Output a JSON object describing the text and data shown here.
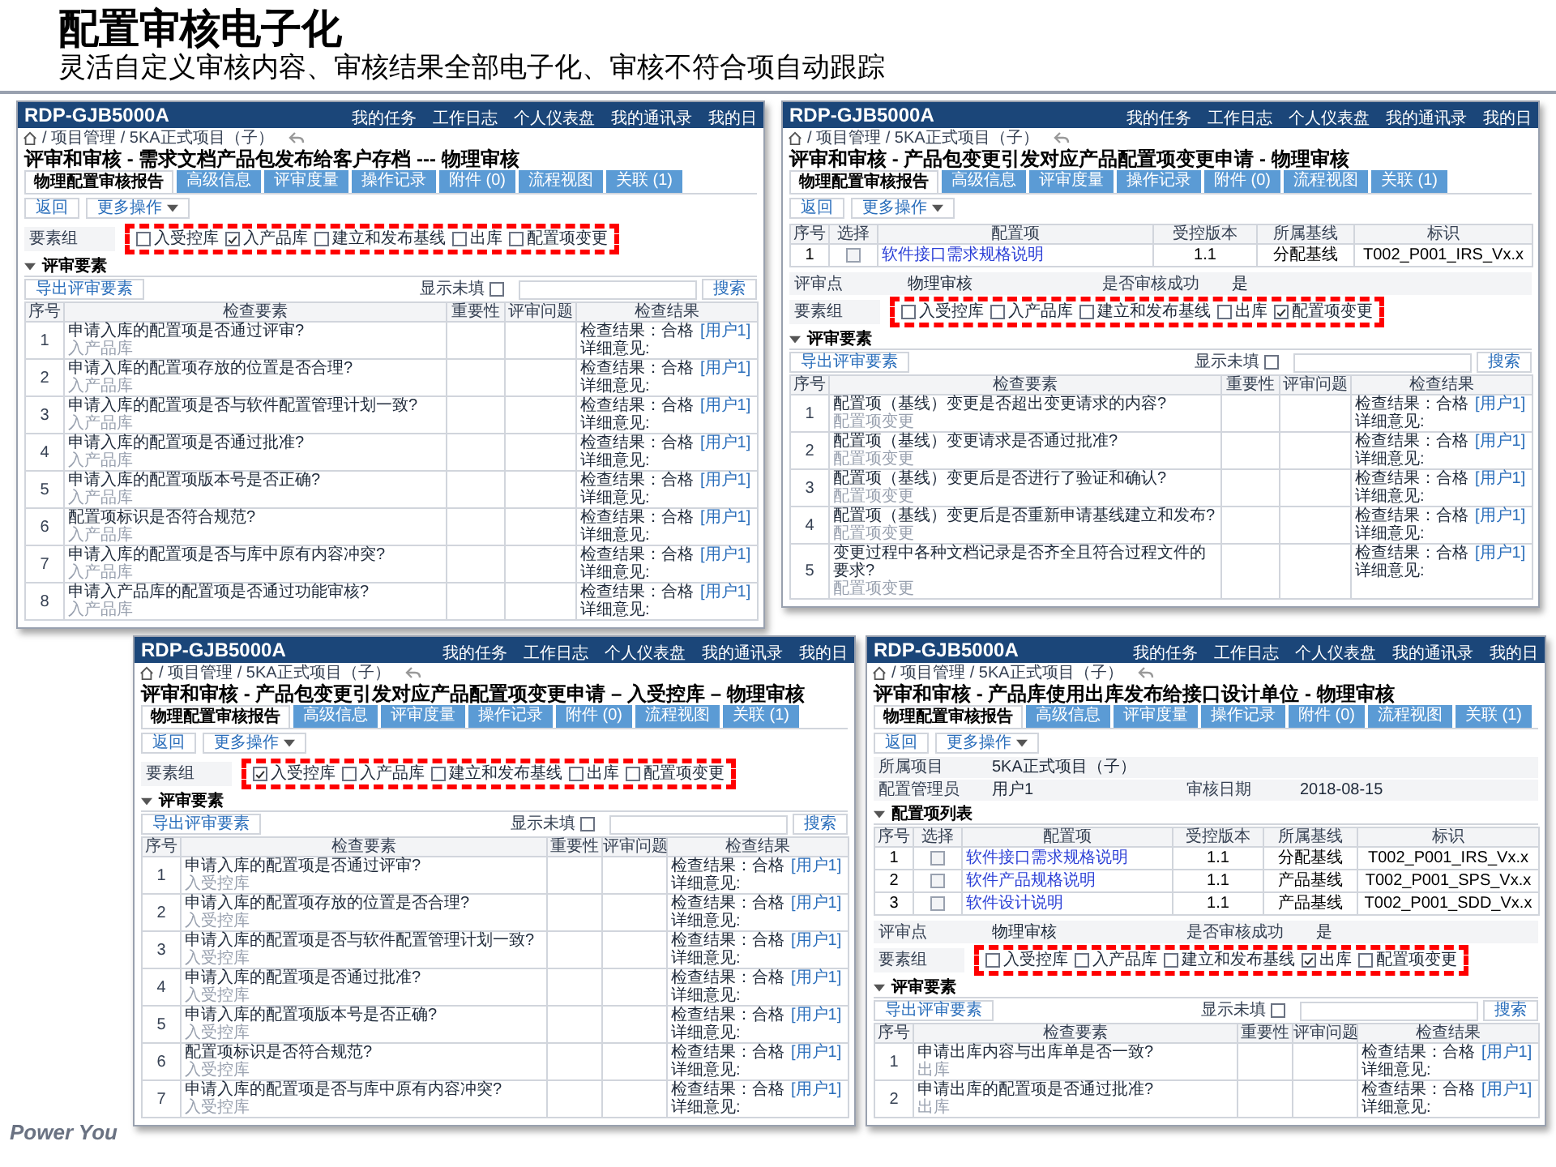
{
  "slide": {
    "title": "配置审核电子化",
    "subtitle": "灵活自定义审核内容、审核结果全部电子化、审核不符合项自动跟踪",
    "footer": "Power You"
  },
  "panels": [
    {
      "app_name": "RDP-GJB5000A",
      "nav": [
        "我的任务",
        "工作日志",
        "个人仪表盘",
        "我的通讯录",
        "我的日"
      ],
      "breadcrumb": "/ 项目管理 / 5KA正式项目（子）",
      "title": "评审和审核 - 需求文档产品包发布给客户存档 --- 物理审核",
      "tabs": [
        {
          "label": "物理配置审核报告",
          "selected": true
        },
        {
          "label": "高级信息",
          "selected": false
        },
        {
          "label": "评审度量",
          "selected": false
        },
        {
          "label": "操作记录",
          "selected": false
        },
        {
          "label": "附件 (0)",
          "selected": false
        },
        {
          "label": "流程视图",
          "selected": false
        },
        {
          "label": "关联 (1)",
          "selected": false
        }
      ],
      "back_button": "返回",
      "more_button": "更多操作",
      "element_group": {
        "label": "要素组",
        "options": [
          {
            "label": "入受控库",
            "checked": false
          },
          {
            "label": "入产品库",
            "checked": true
          },
          {
            "label": "建立和发布基线",
            "checked": false
          },
          {
            "label": "出库",
            "checked": false
          },
          {
            "label": "配置项变更",
            "checked": false
          }
        ]
      },
      "review_section": "评审要素",
      "export_button": "导出评审要素",
      "show_unfilled": {
        "label": "显示未填",
        "checked": false
      },
      "search_button": "搜索",
      "table": {
        "columns": [
          "序号",
          "检查要素",
          "重要性",
          "评审问题",
          "检查结果"
        ],
        "rows": [
          {
            "no": "1",
            "item": "申请入库的配置项是否通过评审?",
            "tag": "入产品库",
            "result": "检查结果：合格",
            "user": "[用户1]",
            "detail": "详细意见:"
          },
          {
            "no": "2",
            "item": "申请入库的配置项存放的位置是否合理?",
            "tag": "入产品库",
            "result": "检查结果：合格",
            "user": "[用户1]",
            "detail": "详细意见:"
          },
          {
            "no": "3",
            "item": "申请入库的配置项是否与软件配置管理计划一致?",
            "tag": "入产品库",
            "result": "检查结果：合格",
            "user": "[用户1]",
            "detail": "详细意见:"
          },
          {
            "no": "4",
            "item": "申请入库的配置项是否通过批准?",
            "tag": "入产品库",
            "result": "检查结果：合格",
            "user": "[用户1]",
            "detail": "详细意见:"
          },
          {
            "no": "5",
            "item": "申请入库的配置项版本号是否正确?",
            "tag": "入产品库",
            "result": "检查结果：合格",
            "user": "[用户1]",
            "detail": "详细意见:"
          },
          {
            "no": "6",
            "item": "配置项标识是否符合规范?",
            "tag": "入产品库",
            "result": "检查结果：合格",
            "user": "[用户1]",
            "detail": "详细意见:"
          },
          {
            "no": "7",
            "item": "申请入库的配置项是否与库中原有内容冲突?",
            "tag": "入产品库",
            "result": "检查结果：合格",
            "user": "[用户1]",
            "detail": "详细意见:"
          },
          {
            "no": "8",
            "item": "申请入产品库的配置项是否通过功能审核?",
            "tag": "入产品库",
            "result": "检查结果：合格",
            "user": "[用户1]",
            "detail": "详细意见:"
          }
        ]
      }
    },
    {
      "app_name": "RDP-GJB5000A",
      "nav": [
        "我的任务",
        "工作日志",
        "个人仪表盘",
        "我的通讯录",
        "我的日"
      ],
      "breadcrumb": "/ 项目管理 / 5KA正式项目（子）",
      "title": "评审和审核 - 产品包变更引发对应产品配置项变更申请 - 物理审核",
      "tabs": [
        {
          "label": "物理配置审核报告",
          "selected": true
        },
        {
          "label": "高级信息",
          "selected": false
        },
        {
          "label": "评审度量",
          "selected": false
        },
        {
          "label": "操作记录",
          "selected": false
        },
        {
          "label": "附件 (0)",
          "selected": false
        },
        {
          "label": "流程视图",
          "selected": false
        },
        {
          "label": "关联 (1)",
          "selected": false
        }
      ],
      "back_button": "返回",
      "more_button": "更多操作",
      "config_table": {
        "columns": [
          "序号",
          "选择",
          "配置项",
          "受控版本",
          "所属基线",
          "标识"
        ],
        "rows": [
          {
            "no": "1",
            "selected": false,
            "item": "软件接口需求规格说明",
            "version": "1.1",
            "baseline": "分配基线",
            "id": "T002_P001_IRS_Vx.x"
          }
        ]
      },
      "review_point": {
        "label": "评审点",
        "value": "物理审核",
        "status_label": "是否审核成功",
        "status": "是"
      },
      "element_group": {
        "label": "要素组",
        "options": [
          {
            "label": "入受控库",
            "checked": false
          },
          {
            "label": "入产品库",
            "checked": false
          },
          {
            "label": "建立和发布基线",
            "checked": false
          },
          {
            "label": "出库",
            "checked": false
          },
          {
            "label": "配置项变更",
            "checked": true
          }
        ]
      },
      "review_section": "评审要素",
      "export_button": "导出评审要素",
      "show_unfilled": {
        "label": "显示未填",
        "checked": false
      },
      "search_button": "搜索",
      "table": {
        "columns": [
          "序号",
          "检查要素",
          "重要性",
          "评审问题",
          "检查结果"
        ],
        "rows": [
          {
            "no": "1",
            "item": "配置项（基线）变更是否超出变更请求的内容?",
            "tag": "配置项变更",
            "result": "检查结果：合格",
            "user": "[用户1]",
            "detail": "详细意见:"
          },
          {
            "no": "2",
            "item": "配置项（基线）变更请求是否通过批准?",
            "tag": "配置项变更",
            "result": "检查结果：合格",
            "user": "[用户1]",
            "detail": "详细意见:"
          },
          {
            "no": "3",
            "item": "配置项（基线）变更后是否进行了验证和确认?",
            "tag": "配置项变更",
            "result": "检查结果：合格",
            "user": "[用户1]",
            "detail": "详细意见:"
          },
          {
            "no": "4",
            "item": "配置项（基线）变更后是否重新申请基线建立和发布?",
            "tag": "配置项变更",
            "result": "检查结果：合格",
            "user": "[用户1]",
            "detail": "详细意见:"
          },
          {
            "no": "5",
            "item": "变更过程中各种文档记录是否齐全且符合过程文件的要求?",
            "tag": "配置项变更",
            "result": "检查结果：合格",
            "user": "[用户1]",
            "detail": "详细意见:"
          }
        ]
      }
    },
    {
      "app_name": "RDP-GJB5000A",
      "nav": [
        "我的任务",
        "工作日志",
        "个人仪表盘",
        "我的通讯录",
        "我的日"
      ],
      "breadcrumb": "/ 项目管理 / 5KA正式项目（子）",
      "title": "评审和审核 - 产品包变更引发对应产品配置项变更申请 – 入受控库 – 物理审核",
      "tabs": [
        {
          "label": "物理配置审核报告",
          "selected": true
        },
        {
          "label": "高级信息",
          "selected": false
        },
        {
          "label": "评审度量",
          "selected": false
        },
        {
          "label": "操作记录",
          "selected": false
        },
        {
          "label": "附件 (0)",
          "selected": false
        },
        {
          "label": "流程视图",
          "selected": false
        },
        {
          "label": "关联 (1)",
          "selected": false
        }
      ],
      "back_button": "返回",
      "more_button": "更多操作",
      "element_group": {
        "label": "要素组",
        "options": [
          {
            "label": "入受控库",
            "checked": true
          },
          {
            "label": "入产品库",
            "checked": false
          },
          {
            "label": "建立和发布基线",
            "checked": false
          },
          {
            "label": "出库",
            "checked": false
          },
          {
            "label": "配置项变更",
            "checked": false
          }
        ]
      },
      "review_section": "评审要素",
      "export_button": "导出评审要素",
      "show_unfilled": {
        "label": "显示未填",
        "checked": false
      },
      "search_button": "搜索",
      "table": {
        "columns": [
          "序号",
          "检查要素",
          "重要性",
          "评审问题",
          "检查结果"
        ],
        "rows": [
          {
            "no": "1",
            "item": "申请入库的配置项是否通过评审?",
            "tag": "入受控库",
            "result": "检查结果：合格",
            "user": "[用户1]",
            "detail": "详细意见:"
          },
          {
            "no": "2",
            "item": "申请入库的配置项存放的位置是否合理?",
            "tag": "入受控库",
            "result": "检查结果：合格",
            "user": "[用户1]",
            "detail": "详细意见:"
          },
          {
            "no": "3",
            "item": "申请入库的配置项是否与软件配置管理计划一致?",
            "tag": "入受控库",
            "result": "检查结果：合格",
            "user": "[用户1]",
            "detail": "详细意见:"
          },
          {
            "no": "4",
            "item": "申请入库的配置项是否通过批准?",
            "tag": "入受控库",
            "result": "检查结果：合格",
            "user": "[用户1]",
            "detail": "详细意见:"
          },
          {
            "no": "5",
            "item": "申请入库的配置项版本号是否正确?",
            "tag": "入受控库",
            "result": "检查结果：合格",
            "user": "[用户1]",
            "detail": "详细意见:"
          },
          {
            "no": "6",
            "item": "配置项标识是否符合规范?",
            "tag": "入受控库",
            "result": "检查结果：合格",
            "user": "[用户1]",
            "detail": "详细意见:"
          },
          {
            "no": "7",
            "item": "申请入库的配置项是否与库中原有内容冲突?",
            "tag": "入受控库",
            "result": "检查结果：合格",
            "user": "[用户1]",
            "detail": "详细意见:"
          }
        ]
      }
    },
    {
      "app_name": "RDP-GJB5000A",
      "nav": [
        "我的任务",
        "工作日志",
        "个人仪表盘",
        "我的通讯录",
        "我的日"
      ],
      "breadcrumb": "/ 项目管理 / 5KA正式项目（子）",
      "title": "评审和审核 - 产品库使用出库发布给接口设计单位 - 物理审核",
      "tabs": [
        {
          "label": "物理配置审核报告",
          "selected": true
        },
        {
          "label": "高级信息",
          "selected": false
        },
        {
          "label": "评审度量",
          "selected": false
        },
        {
          "label": "操作记录",
          "selected": false
        },
        {
          "label": "附件 (0)",
          "selected": false
        },
        {
          "label": "流程视图",
          "selected": false
        },
        {
          "label": "关联 (1)",
          "selected": false
        }
      ],
      "back_button": "返回",
      "more_button": "更多操作",
      "info_rows": [
        [
          {
            "label": "所属项目",
            "value": "5KA正式项目（子）"
          }
        ],
        [
          {
            "label": "配置管理员",
            "value": "用户1"
          },
          {
            "label": "审核日期",
            "value": "2018-08-15"
          }
        ]
      ],
      "config_section": "配置项列表",
      "config_table": {
        "columns": [
          "序号",
          "选择",
          "配置项",
          "受控版本",
          "所属基线",
          "标识"
        ],
        "rows": [
          {
            "no": "1",
            "selected": false,
            "item": "软件接口需求规格说明",
            "version": "1.1",
            "baseline": "分配基线",
            "id": "T002_P001_IRS_Vx.x"
          },
          {
            "no": "2",
            "selected": false,
            "item": "软件产品规格说明",
            "version": "1.1",
            "baseline": "产品基线",
            "id": "T002_P001_SPS_Vx.x"
          },
          {
            "no": "3",
            "selected": false,
            "item": "软件设计说明",
            "version": "1.1",
            "baseline": "产品基线",
            "id": "T002_P001_SDD_Vx.x"
          }
        ]
      },
      "review_point": {
        "label": "评审点",
        "value": "物理审核",
        "status_label": "是否审核成功",
        "status": "是"
      },
      "element_group": {
        "label": "要素组",
        "options": [
          {
            "label": "入受控库",
            "checked": false
          },
          {
            "label": "入产品库",
            "checked": false
          },
          {
            "label": "建立和发布基线",
            "checked": false
          },
          {
            "label": "出库",
            "checked": true
          },
          {
            "label": "配置项变更",
            "checked": false
          }
        ]
      },
      "review_section": "评审要素",
      "export_button": "导出评审要素",
      "show_unfilled": {
        "label": "显示未填",
        "checked": false
      },
      "search_button": "搜索",
      "table": {
        "columns": [
          "序号",
          "检查要素",
          "重要性",
          "评审问题",
          "检查结果"
        ],
        "rows": [
          {
            "no": "1",
            "item": "申请出库内容与出库单是否一致?",
            "tag": "出库",
            "result": "检查结果：合格",
            "user": "[用户1]",
            "detail": "详细意见:"
          },
          {
            "no": "2",
            "item": "申请出库的配置项是否通过批准?",
            "tag": "出库",
            "result": "检查结果：合格",
            "user": "[用户1]",
            "detail": "详细意见:"
          }
        ]
      }
    }
  ]
}
